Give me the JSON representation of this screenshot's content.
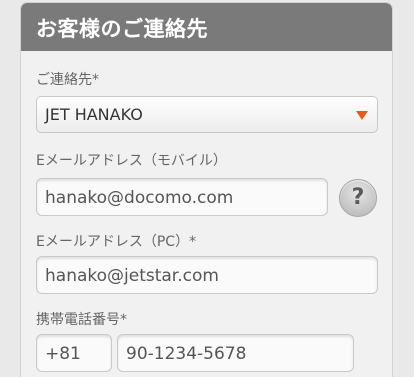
{
  "panel": {
    "title": "お客様のご連絡先"
  },
  "contact": {
    "label": "ご連絡先*",
    "selected": "JET HANAKO",
    "arrow_color": "#e35a1c"
  },
  "email_mobile": {
    "label": "Eメールアドレス（モバイル）",
    "value": "hanako@docomo.com",
    "help_glyph": "?",
    "help_icon": "question-icon"
  },
  "email_pc": {
    "label": "Eメールアドレス（PC）*",
    "value": "hanako@jetstar.com"
  },
  "mobile_phone": {
    "label": "携帯電話番号*",
    "country_code": "+81",
    "number": "90-1234-5678"
  },
  "colors": {
    "header_bg": "#7a7a7a",
    "panel_bg": "#f1f1f1",
    "accent": "#e35a1c"
  }
}
